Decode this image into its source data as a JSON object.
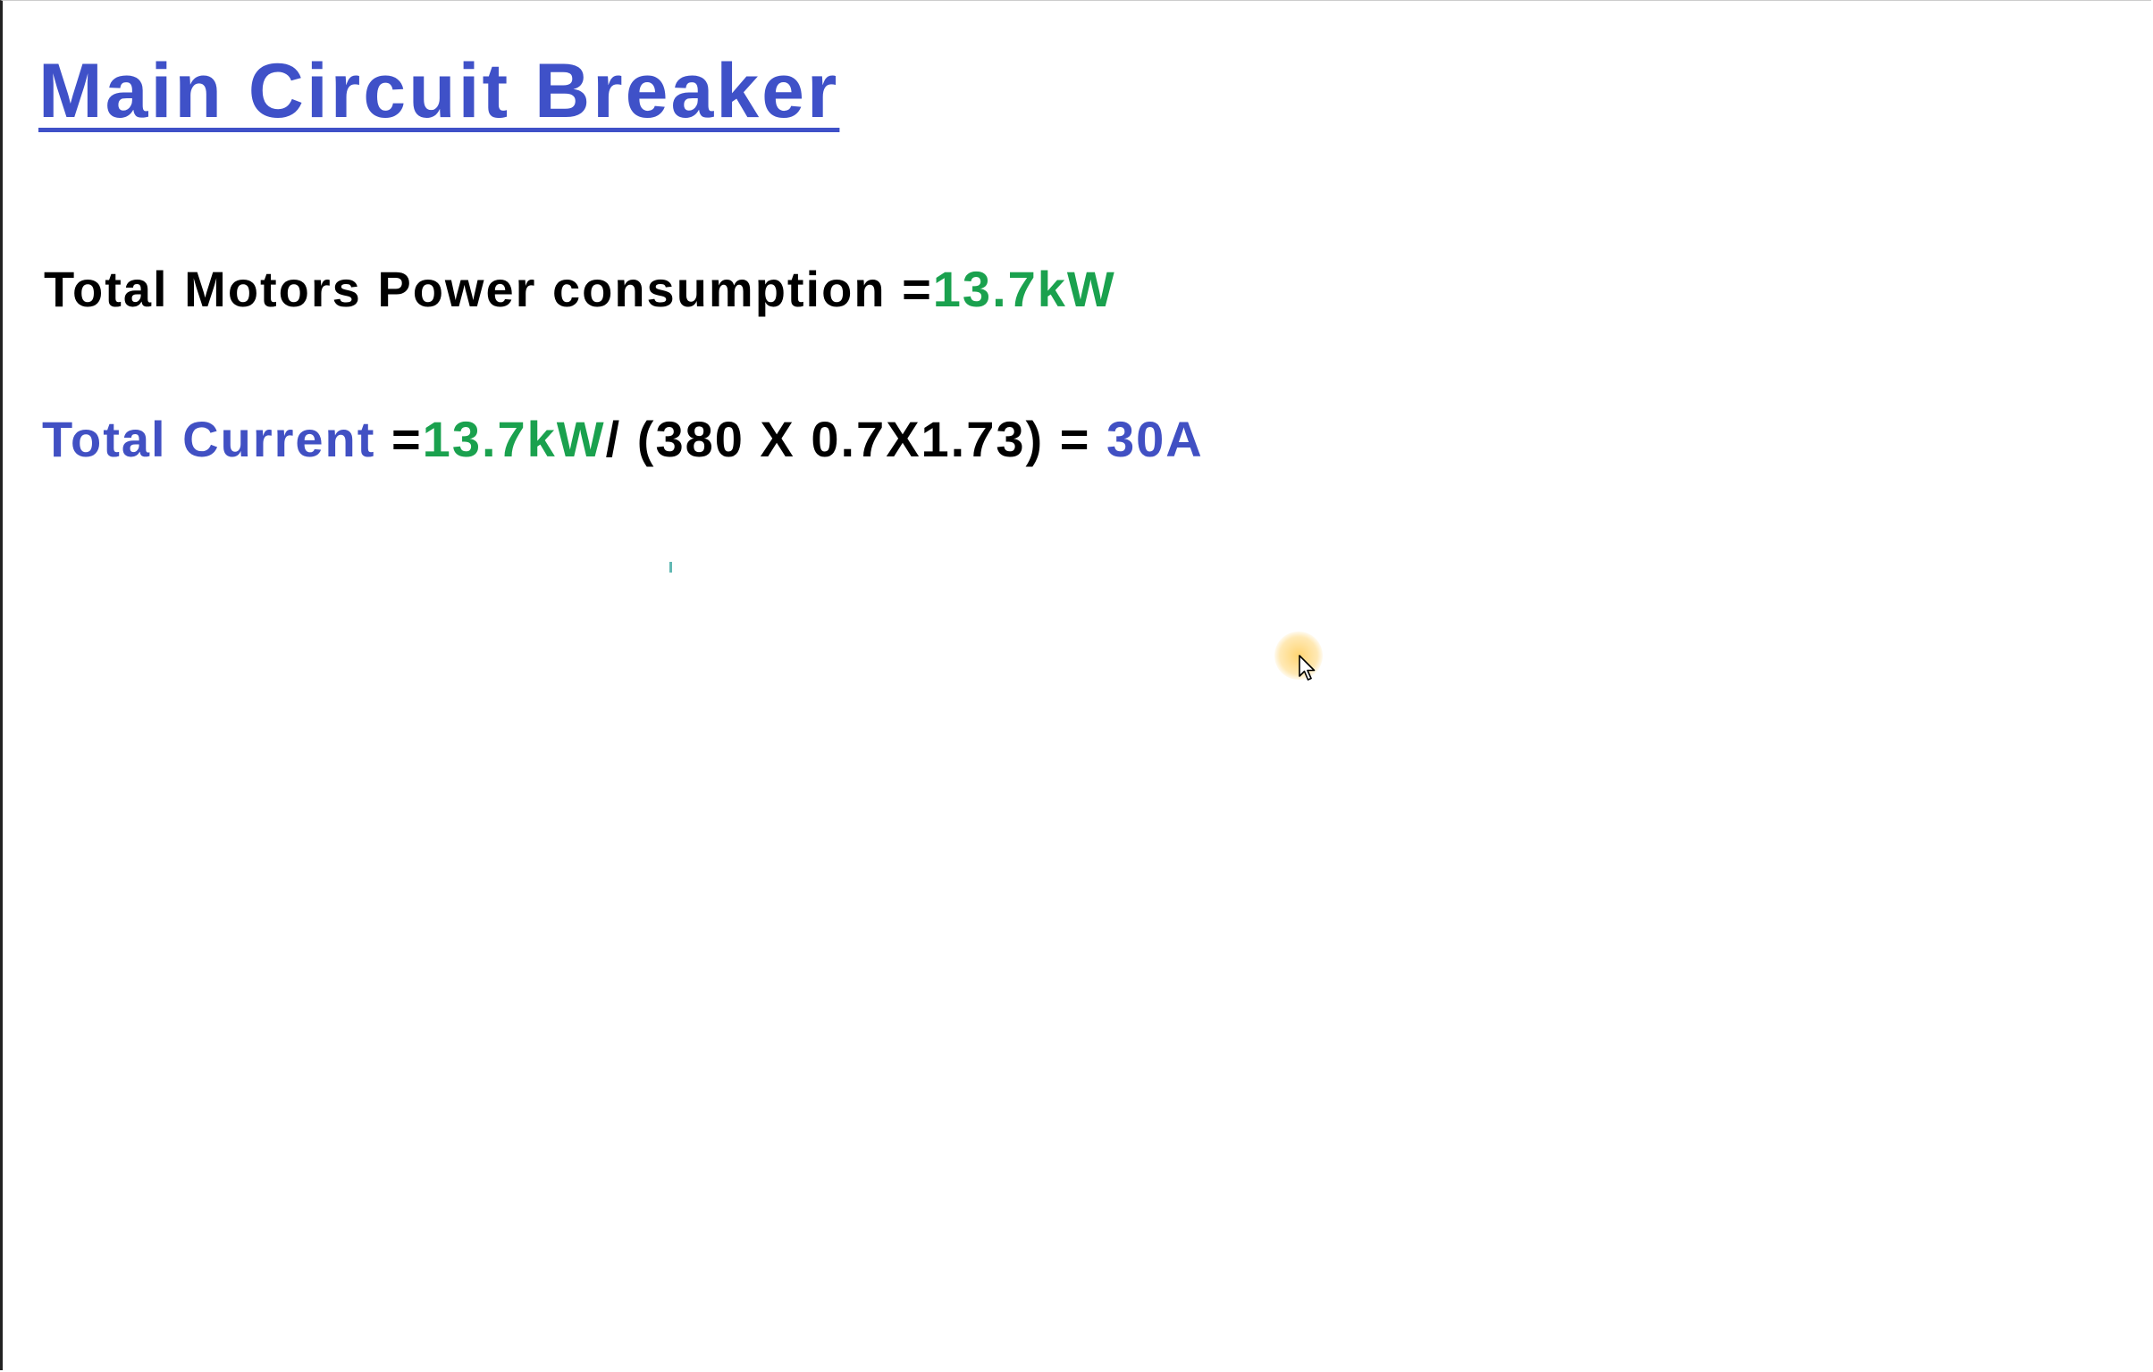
{
  "title": "Main Circuit Breaker",
  "line1": {
    "label": "Total Motors Power consumption =",
    "value": "13.7kW"
  },
  "line2": {
    "label": "Total Current",
    "equals": " =",
    "power": "13.7kW",
    "formula": "/ (380 X 0.7X1.73) = ",
    "result": "30A"
  },
  "colors": {
    "title": "#3f51c8",
    "label_blue": "#4150c3",
    "value_green": "#1aa14e",
    "text": "#000000"
  },
  "cursor": {
    "icon": "mouse-pointer-icon",
    "highlight": "#ffd36b"
  }
}
